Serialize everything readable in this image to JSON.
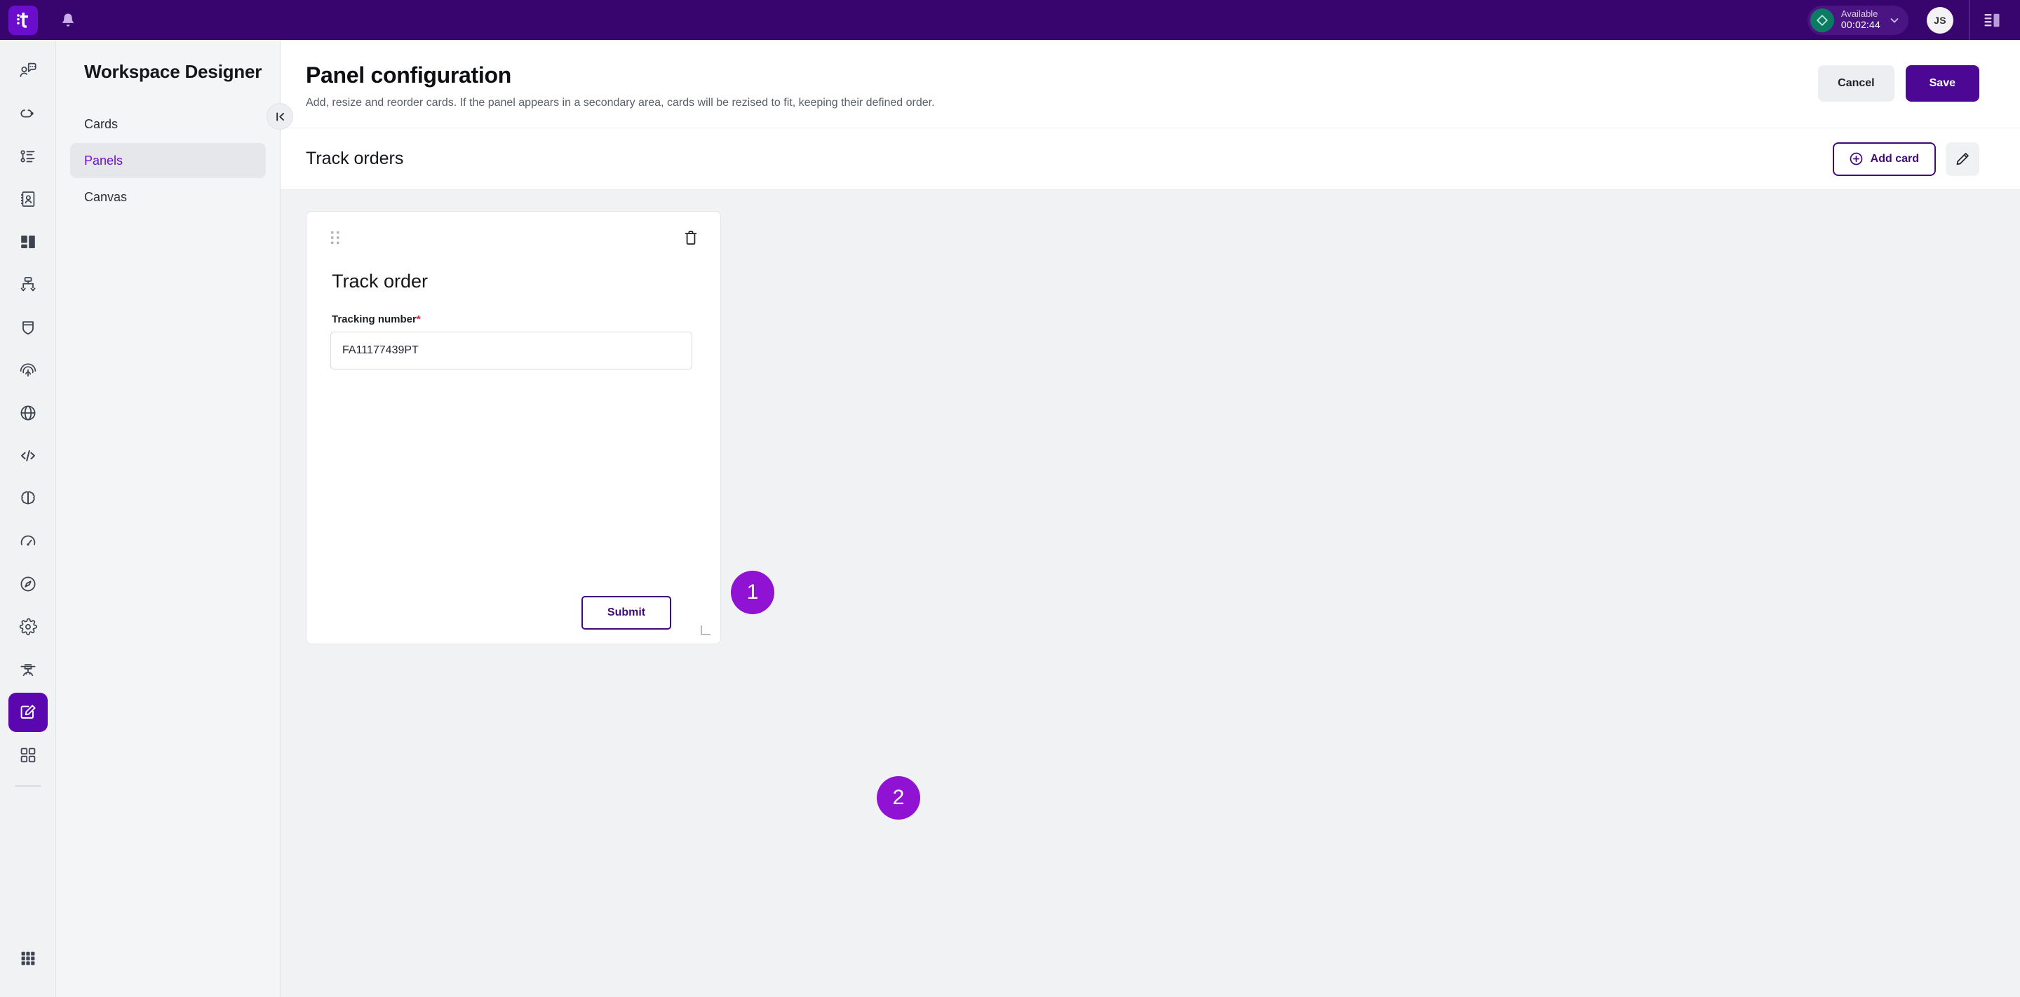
{
  "topbar": {
    "logo_name": "it-logo",
    "notifications_label": "Notifications",
    "status": {
      "label": "Available",
      "timer": "00:02:44"
    },
    "avatar_initials": "JS",
    "panel_toggle_label": "Toggle side panel"
  },
  "rail": {
    "items": [
      {
        "name": "chat-question-icon",
        "label": "Conversations"
      },
      {
        "name": "link-icon",
        "label": "Connections"
      },
      {
        "name": "task-list-icon",
        "label": "Tasks"
      },
      {
        "name": "contact-book-icon",
        "label": "Contacts"
      },
      {
        "name": "layout-blocks-icon",
        "label": "Layouts"
      },
      {
        "name": "routing-icon",
        "label": "Routing"
      },
      {
        "name": "shield-icon",
        "label": "Security"
      },
      {
        "name": "fingerprint-icon",
        "label": "Identity"
      },
      {
        "name": "globe-icon",
        "label": "Global"
      },
      {
        "name": "code-icon",
        "label": "Developer"
      },
      {
        "name": "brain-icon",
        "label": "AI"
      },
      {
        "name": "gauge-icon",
        "label": "Performance"
      },
      {
        "name": "compass-icon",
        "label": "Explore"
      },
      {
        "name": "gear-icon",
        "label": "Settings"
      },
      {
        "name": "graduation-cap-icon",
        "label": "Learning"
      },
      {
        "name": "workspace-designer-icon",
        "label": "Workspace Designer",
        "active": true
      },
      {
        "name": "grid-cards-icon",
        "label": "Apps"
      }
    ],
    "bottom_item": {
      "name": "apps-grid-icon",
      "label": "All apps"
    }
  },
  "subnav": {
    "title": "Workspace Designer",
    "collapse_label": "Collapse panel",
    "items": [
      {
        "label": "Cards",
        "active": false
      },
      {
        "label": "Panels",
        "active": true
      },
      {
        "label": "Canvas",
        "active": false
      }
    ]
  },
  "main": {
    "page_title": "Panel configuration",
    "page_subtitle": "Add, resize and reorder cards. If the panel appears in a secondary area, cards will be rezised to fit, keeping their defined order.",
    "cancel_label": "Cancel",
    "save_label": "Save",
    "panel_name": "Track orders",
    "add_card_label": "Add card",
    "edit_panel_label": "Edit panel"
  },
  "card": {
    "title": "Track order",
    "drag_label": "Drag card",
    "delete_label": "Delete card",
    "resize_label": "Resize card",
    "field": {
      "label": "Tracking number",
      "required_mark": "*",
      "value": "FA11177439PT",
      "placeholder": "Tracking number"
    },
    "submit_label": "Submit"
  },
  "annotations": {
    "badges": [
      {
        "id": "badge1",
        "number": "1"
      },
      {
        "id": "badge2",
        "number": "2"
      }
    ]
  },
  "colors": {
    "topbar": "#38046e",
    "brand_purple": "#4c0894",
    "accent_purple": "#6a0dcc",
    "badge_purple": "#9013d4",
    "available_green": "#0d7a63",
    "required_red": "#e8203a",
    "canvas_gray": "#f1f2f4"
  }
}
